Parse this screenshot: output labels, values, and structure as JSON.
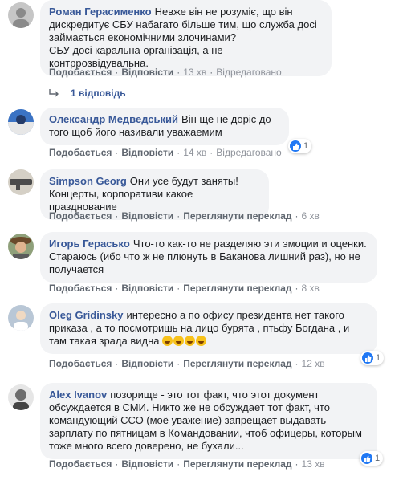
{
  "comments": [
    {
      "author": "Роман Герасименко",
      "text": "Невже він не розуміє, що він дискредитує СБУ набагато більше тим, що служба досі займається економічними злочинами?\nСБУ досі каральна організація, а не контррозвідувальна.",
      "actions": [
        "Подобається",
        "Відповісти"
      ],
      "time": "13 хв",
      "extra": "Відредаговано"
    },
    {
      "author": "Олександр Медведський",
      "text": "Він ще не доріс до того щоб його називали уважаемим",
      "actions": [
        "Подобається",
        "Відповісти"
      ],
      "time": "14 хв",
      "extra": "Відредаговано",
      "reactions": "1"
    },
    {
      "author": "Simpson Georg",
      "text": "Они усе будут заняты!\nКонцерты, корпоративи какое празднование",
      "actions": [
        "Подобається",
        "Відповісти",
        "Переглянути переклад"
      ],
      "time": "6 хв"
    },
    {
      "author": "Игорь Гераськo",
      "text": "Что-то как-то не разделяю эти эмоции и оценки. Стараюсь (ибо что ж не плюнуть в Баканова лишний раз), но не получается",
      "actions": [
        "Подобається",
        "Відповісти",
        "Переглянути переклад"
      ],
      "time": "8 хв"
    },
    {
      "author": "Oleg Gridinsky",
      "text": "интересно а по офису президента нет такого приказа , а то посмотришь на лицо бурята , птьфу Богдана , и там такая зрада видна",
      "actions": [
        "Подобається",
        "Відповісти",
        "Переглянути переклад"
      ],
      "time": "12 хв",
      "reactions": "1"
    },
    {
      "author": "Alex Ivanov",
      "text": "позорище - это тот факт, что этот документ обсуждается в СМИ. Никто же не обсуждает тот факт, что командующий ССО (моё уважение) запрещает выдавать зарплату по пятницам в Командовании, чтоб офицеры, которым тоже много всего доверено, не бухали...",
      "actions": [
        "Подобається",
        "Відповісти",
        "Переглянути переклад"
      ],
      "time": "13 хв",
      "reactions": "1"
    }
  ],
  "replies_link": "1 відповідь"
}
